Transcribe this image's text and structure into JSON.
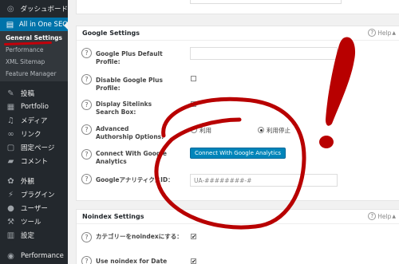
{
  "sidebar": {
    "items": [
      {
        "label": "ダッシュボード",
        "icon": "dashboard-icon",
        "glyph": "◎"
      },
      {
        "label": "All in One SEO",
        "icon": "seo-icon",
        "glyph": "▤"
      },
      {
        "label": "投稿",
        "icon": "pin-icon",
        "glyph": "✎"
      },
      {
        "label": "Portfolio",
        "icon": "portfolio-icon",
        "glyph": "▦"
      },
      {
        "label": "メディア",
        "icon": "media-icon",
        "glyph": "♫"
      },
      {
        "label": "リンク",
        "icon": "link-icon",
        "glyph": "∞"
      },
      {
        "label": "固定ページ",
        "icon": "pages-icon",
        "glyph": "▢"
      },
      {
        "label": "コメント",
        "icon": "comments-icon",
        "glyph": "▰"
      },
      {
        "label": "外観",
        "icon": "appearance-icon",
        "glyph": "✿"
      },
      {
        "label": "プラグイン",
        "icon": "plugins-icon",
        "glyph": "⚡"
      },
      {
        "label": "ユーザー",
        "icon": "users-icon",
        "glyph": "●"
      },
      {
        "label": "ツール",
        "icon": "tools-icon",
        "glyph": "⚒"
      },
      {
        "label": "設定",
        "icon": "settings-icon",
        "glyph": "▥"
      },
      {
        "label": "Performance",
        "icon": "performance-icon",
        "glyph": "◉"
      }
    ],
    "submenu": [
      "General Settings",
      "Performance",
      "XML Sitemap",
      "Feature Manager"
    ]
  },
  "google": {
    "title": "Google Settings",
    "help": "Help",
    "plus_label": "Google Plus Default Profile:",
    "disable_plus_label": "Disable Google Plus Profile:",
    "sitelinks_label": "Display Sitelinks Search Box:",
    "authorship_label": "Advanced Authorship Options:",
    "radio_use": "利用",
    "radio_stop": "利用停止",
    "connect_label": "Connect With Google Analytics",
    "connect_button": "Connect With Google Analytics",
    "analytics_id_label": "GoogleアナリティクスID：",
    "analytics_placeholder": "UA-########-#"
  },
  "noindex": {
    "title": "Noindex Settings",
    "help": "Help",
    "category_label": "カテゴリーをnoindexにする：",
    "date_label": "Use noindex for Date"
  },
  "colors": {
    "annotation": "#b80000",
    "accent": "#0073aa",
    "sidebar": "#23282d"
  }
}
